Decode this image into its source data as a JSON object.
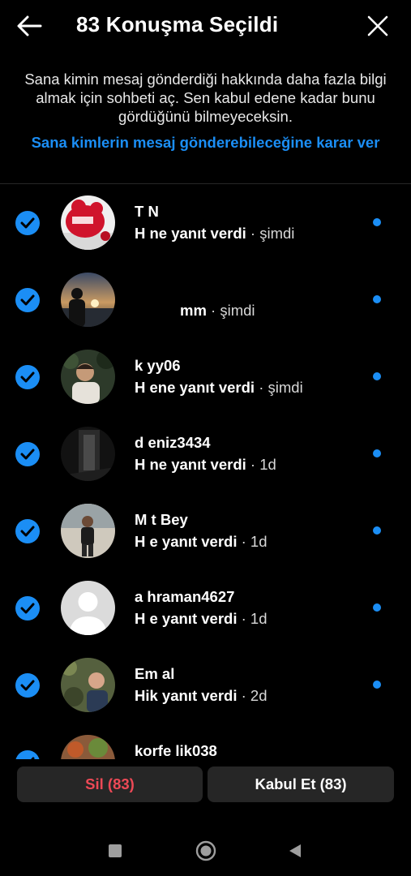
{
  "header": {
    "title": "83 Konuşma Seçildi",
    "back_icon": "arrow-left-icon",
    "close_icon": "close-icon"
  },
  "info": {
    "text": "Sana kimin mesaj gönderdiği hakkında daha fazla bilgi almak için sohbeti aç. Sen kabul edene kadar bunu gördüğünü bilmeyeceksin.",
    "link": "Sana kimlerin mesaj gönderebileceğine karar ver"
  },
  "conversations": [
    {
      "name": "T            N",
      "message": "H          ne yanıt verdi",
      "time": "şimdi"
    },
    {
      "name": "",
      "message": "mm",
      "time": "şimdi"
    },
    {
      "name": "k        yy06",
      "message": "H          ene yanıt verdi",
      "time": "şimdi"
    },
    {
      "name": "d      eniz3434",
      "message": "H          ne yanıt verdi",
      "time": "1d"
    },
    {
      "name": "M        t Bey",
      "message": "H          e yanıt verdi",
      "time": "1d"
    },
    {
      "name": "a        hraman4627",
      "message": "H          e yanıt verdi",
      "time": "1d"
    },
    {
      "name": "Em         al",
      "message": "Hik          yanıt verdi",
      "time": "2d"
    },
    {
      "name": "korfe       lik038",
      "message": "",
      "time": ""
    }
  ],
  "footer": {
    "delete_label": "Sil (83)",
    "accept_label": "Kabul Et (83)"
  },
  "colors": {
    "accent": "#1b8ef5",
    "danger": "#ed4956",
    "background": "#000000",
    "button_bg": "#262626"
  },
  "nav": {
    "recents_icon": "square-icon",
    "home_icon": "circle-home-icon",
    "back_icon": "triangle-back-icon"
  }
}
